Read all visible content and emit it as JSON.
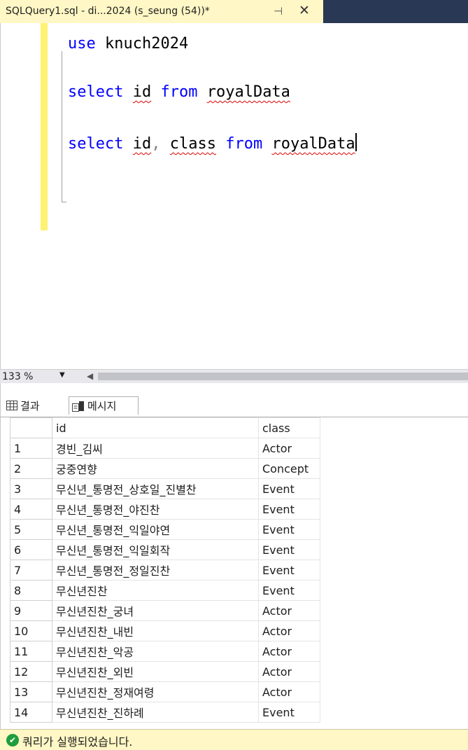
{
  "tab": {
    "title": "SQLQuery1.sql - di...2024 (s_seung (54))*",
    "pin_glyph": "⊣",
    "close_glyph": "✕"
  },
  "editor": {
    "lines": [
      {
        "keyword": "use",
        "rest": "knuch2024"
      },
      {
        "k1": "select",
        "id": "id",
        "k2": "from",
        "table": "royalData"
      },
      {
        "k1": "select",
        "id": "id",
        "comma": ",",
        "col": "class",
        "k2": "from",
        "table": "royalData"
      }
    ]
  },
  "zoom": {
    "value": "133 %",
    "arrow": "▼"
  },
  "scroll": {
    "left_glyph": "◀"
  },
  "results_tabs": {
    "results_label": "결과",
    "messages_label": "메시지",
    "results_icon": "grid-icon",
    "messages_icon": "messages-icon"
  },
  "grid": {
    "headers": [
      "id",
      "class"
    ],
    "rows": [
      {
        "n": "1",
        "id": "경빈_김씨",
        "class": "Actor"
      },
      {
        "n": "2",
        "id": "궁중연향",
        "class": "Concept"
      },
      {
        "n": "3",
        "id": "무신년_통명전_상호일_진별찬",
        "class": "Event"
      },
      {
        "n": "4",
        "id": "무신년_통명전_야진찬",
        "class": "Event"
      },
      {
        "n": "5",
        "id": "무신년_통명전_익일야연",
        "class": "Event"
      },
      {
        "n": "6",
        "id": "무신년_통명전_익일회작",
        "class": "Event"
      },
      {
        "n": "7",
        "id": "무신년_통명전_정일진찬",
        "class": "Event"
      },
      {
        "n": "8",
        "id": "무신년진찬",
        "class": "Event"
      },
      {
        "n": "9",
        "id": "무신년진찬_궁녀",
        "class": "Actor"
      },
      {
        "n": "10",
        "id": "무신년진찬_내빈",
        "class": "Actor"
      },
      {
        "n": "11",
        "id": "무신년진찬_악공",
        "class": "Actor"
      },
      {
        "n": "12",
        "id": "무신년진찬_외빈",
        "class": "Actor"
      },
      {
        "n": "13",
        "id": "무신년진찬_정재여령",
        "class": "Actor"
      },
      {
        "n": "14",
        "id": "무신년진찬_진하례",
        "class": "Event"
      }
    ]
  },
  "status": {
    "text": "쿼리가 실행되었습니다.",
    "icon": "check-circle-icon",
    "icon_color": "#1e9e3e"
  },
  "colors": {
    "keyword": "#0000ff",
    "tab_active": "#fff7c5",
    "titlebar": "#293955",
    "change_bar": "#fff173"
  }
}
